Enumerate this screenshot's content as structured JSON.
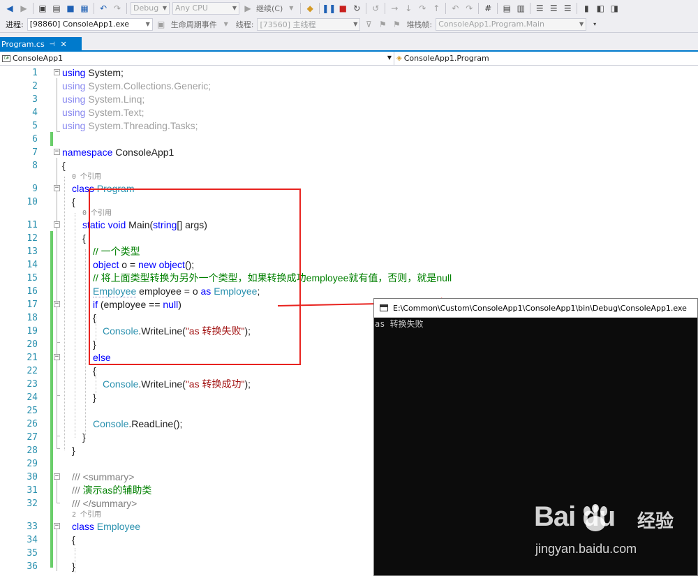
{
  "toolbar": {
    "config": "Debug",
    "platform": "Any CPU",
    "continue_label": "继续(C)",
    "process_label": "进程:",
    "process_value": "[98860] ConsoleApp1.exe",
    "lifecycle_label": "生命周期事件",
    "thread_label": "线程:",
    "thread_value": "[73560] 主线程",
    "stackframe_label": "堆栈帧:",
    "stackframe_value": "ConsoleApp1.Program.Main"
  },
  "tabs": [
    {
      "label": "Program.cs",
      "active": true
    }
  ],
  "navbar": {
    "project": "ConsoleApp1",
    "type": "ConsoleApp1.Program"
  },
  "editor": {
    "line_numbers": [
      "1",
      "2",
      "3",
      "4",
      "5",
      "6",
      "7",
      "8",
      "9",
      "10",
      "11",
      "12",
      "13",
      "14",
      "15",
      "16",
      "17",
      "18",
      "19",
      "20",
      "21",
      "22",
      "23",
      "24",
      "25",
      "26",
      "27",
      "28",
      "29",
      "30",
      "31",
      "32",
      "33",
      "34",
      "35",
      "36"
    ],
    "codelens": {
      "class_program": "0 个引用",
      "main": "0 个引用",
      "class_employee": "2 个引用"
    },
    "lines": {
      "l1_kw": "using",
      "l1_rest": " System;",
      "l2_kw": "using",
      "l2_rest": " System.Collections.Generic;",
      "l3_kw": "using",
      "l3_rest": " System.Linq;",
      "l4_kw": "using",
      "l4_rest": " System.Text;",
      "l5_kw": "using",
      "l5_rest": " System.Threading.Tasks;",
      "l7_kw": "namespace",
      "l7_rest": " ConsoleApp1",
      "l8": "{",
      "l9_kw": "class",
      "l9_ty": "Program",
      "l10": "{",
      "l11_kw1": "static",
      "l11_kw2": "void",
      "l11_a": " Main(",
      "l11_kw3": "string",
      "l11_b": "[] args)",
      "l12": "{",
      "l13": "// 一个类型",
      "l14_kw1": "object",
      "l14_a": " o = ",
      "l14_kw2": "new",
      "l14_kw3": "object",
      "l14_b": "();",
      "l15": "// 将上面类型转换为另外一个类型，如果转换成功employee就有值，否则，就是null",
      "l16_ty1": "Employee",
      "l16_a": " employee = o ",
      "l16_kw": "as",
      "l16_ty2": "Employee",
      "l16_b": ";",
      "l17_kw": "if",
      "l17_a": " (employee == ",
      "l17_kw2": "null",
      "l17_b": ")",
      "l18": "{",
      "l19_ty": "Console",
      "l19_a": ".WriteLine(",
      "l19_str": "\"as 转换失败\"",
      "l19_b": ");",
      "l20": "}",
      "l21_kw": "else",
      "l22": "{",
      "l23_ty": "Console",
      "l23_a": ".WriteLine(",
      "l23_str": "\"as 转换成功\"",
      "l23_b": ");",
      "l24": "}",
      "l26_ty": "Console",
      "l26_a": ".ReadLine();",
      "l27": "}",
      "l28": "}",
      "l30": "/// <summary>",
      "l31_a": "/// ",
      "l31_b": "演示as的辅助类",
      "l32": "/// </summary>",
      "l33_kw": "class",
      "l33_ty": "Employee",
      "l34": "{",
      "l36": "}"
    }
  },
  "console": {
    "title": "E:\\Common\\Custom\\ConsoleApp1\\ConsoleApp1\\bin\\Debug\\ConsoleApp1.exe",
    "output": "as 转换失败"
  },
  "watermark": {
    "logo": "Bai  du",
    "cn": "经验",
    "url": "jingyan.baidu.com"
  },
  "colors": {
    "accent": "#007acc",
    "annotation": "#e8231f",
    "keyword": "#0000ff",
    "type": "#2b91af",
    "comment": "#008000",
    "string": "#a31515"
  }
}
